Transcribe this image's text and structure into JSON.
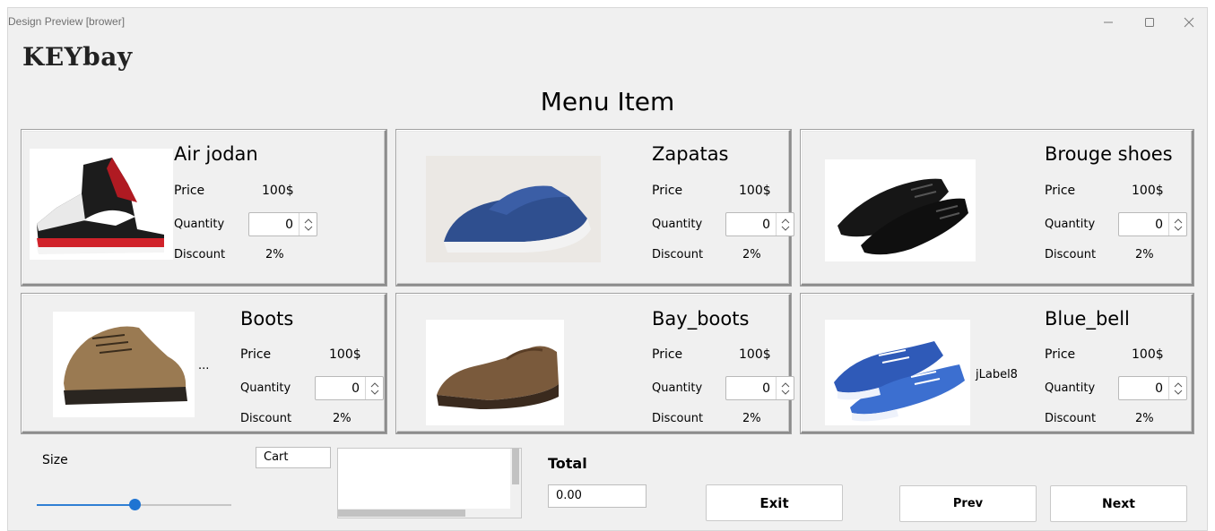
{
  "window": {
    "title": "Design Preview [brower]",
    "controls": [
      "minimize",
      "maximize",
      "close"
    ]
  },
  "brand": "KEYbay",
  "heading": "Menu Item",
  "common_labels": {
    "price": "Price",
    "quantity": "Quantity",
    "discount": "Discount"
  },
  "products": [
    {
      "name": "Air jodan",
      "price": "100$",
      "quantity": "0",
      "discount": "2%",
      "image": "high-top-sneaker"
    },
    {
      "name": "Zapatas",
      "price": "100$",
      "quantity": "0",
      "discount": "2%",
      "image": "blue-canvas-shoe"
    },
    {
      "name": "Brouge shoes",
      "price": "100$",
      "quantity": "0",
      "discount": "2%",
      "image": "black-oxford-shoes"
    },
    {
      "name": "Boots",
      "price": "100$",
      "quantity": "0",
      "discount": "2%",
      "image": "brown-lace-boot",
      "extra_label": "..."
    },
    {
      "name": "Bay_boots",
      "price": "100$",
      "quantity": "0",
      "discount": "2%",
      "image": "brown-slip-on-shoe"
    },
    {
      "name": "Blue_bell",
      "price": "100$",
      "quantity": "0",
      "discount": "2%",
      "image": "blue-running-sneakers",
      "extra_label": "jLabel8"
    }
  ],
  "footer": {
    "size_label": "Size",
    "size_slider_value": 0.5,
    "cart_field": "Cart",
    "total_label": "Total",
    "total_value": "0.00",
    "exit_button": "Exit",
    "prev_button": "Prev",
    "next_button": "Next"
  },
  "colors": {
    "window_bg": "#f0f0f0",
    "slider_accent": "#1f74d2"
  }
}
